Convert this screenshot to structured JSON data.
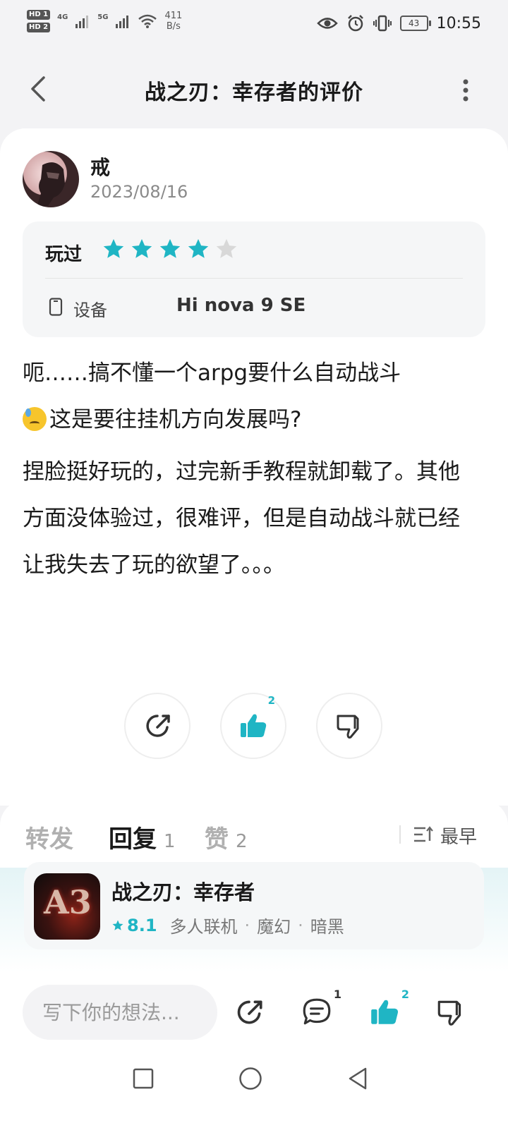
{
  "status_bar": {
    "hd1": "HD 1",
    "hd2": "HD 2",
    "net1": "4G",
    "net2": "5G",
    "speed_value": "411",
    "speed_unit": "B/s",
    "battery": "43",
    "time": "10:55"
  },
  "header": {
    "title": "战之刃：幸存者的评价"
  },
  "review": {
    "username": "戒",
    "date": "2023/08/16",
    "played_label": "玩过",
    "rating_stars": 4,
    "rating_max": 5,
    "device_label": "设备",
    "device_value": "Hi nova 9 SE",
    "para1_a": "呃……搞不懂一个arpg要什么自动战斗",
    "para1_b": "这是要往挂机方向发展吗?",
    "para2": "捏脸挺好玩的，过完新手教程就卸载了。其他方面没体验过，很难评，但是自动战斗就已经让我失去了玩的欲望了。。。",
    "like_count": "2"
  },
  "tabs": {
    "forward": "转发",
    "reply": "回复",
    "reply_count": "1",
    "like": "赞",
    "like_count": "2",
    "sort": "最早"
  },
  "app": {
    "icon_text": "A3",
    "name": "战之刃：幸存者",
    "rating": "8.1",
    "tags": [
      "多人联机",
      "魔幻",
      "暗黑"
    ]
  },
  "bottom_bar": {
    "placeholder": "写下你的想法...",
    "comment_count": "1",
    "like_count": "2"
  },
  "colors": {
    "accent": "#1fb5c4",
    "star_empty": "#d8d8d8"
  }
}
